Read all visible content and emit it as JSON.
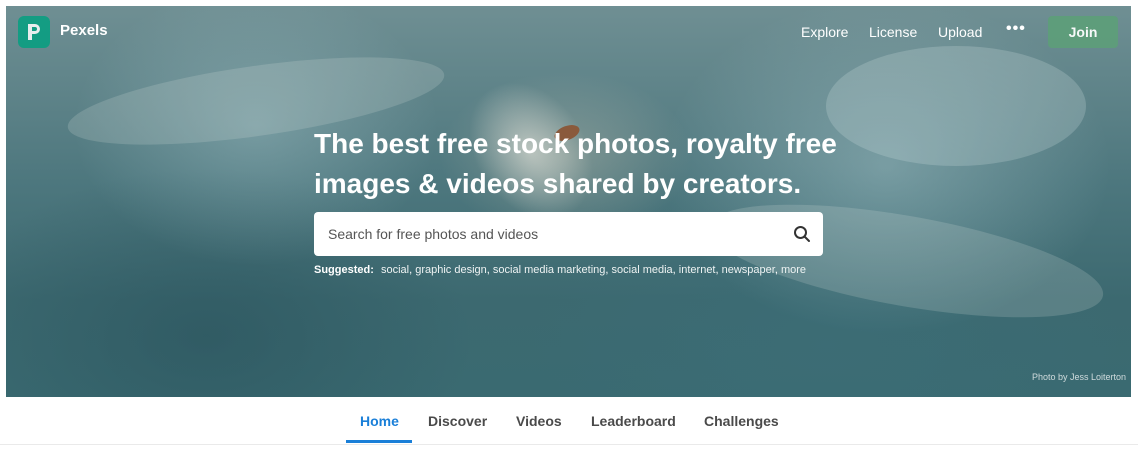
{
  "brand": {
    "name": "Pexels",
    "logo_letter": "P"
  },
  "nav": {
    "links": [
      "Explore",
      "License",
      "Upload"
    ],
    "more_icon": "ellipsis-icon",
    "join_label": "Join"
  },
  "hero": {
    "headline_line1": "The best free stock photos, royalty free",
    "headline_line2": "images & videos shared by creators.",
    "search_placeholder": "Search for free photos and videos",
    "search_icon": "search-icon",
    "suggested_label": "Suggested:",
    "suggestions": [
      "social",
      "graphic design",
      "social media marketing",
      "social media",
      "internet",
      "newspaper",
      "more"
    ],
    "photo_credit": "Photo by Jess Loiterton"
  },
  "tabs": {
    "items": [
      "Home",
      "Discover",
      "Videos",
      "Leaderboard",
      "Challenges"
    ],
    "active": "Home"
  },
  "colors": {
    "accent": "#1a7fd8",
    "join_button": "#5e9e7a",
    "logo": "#05a081"
  }
}
